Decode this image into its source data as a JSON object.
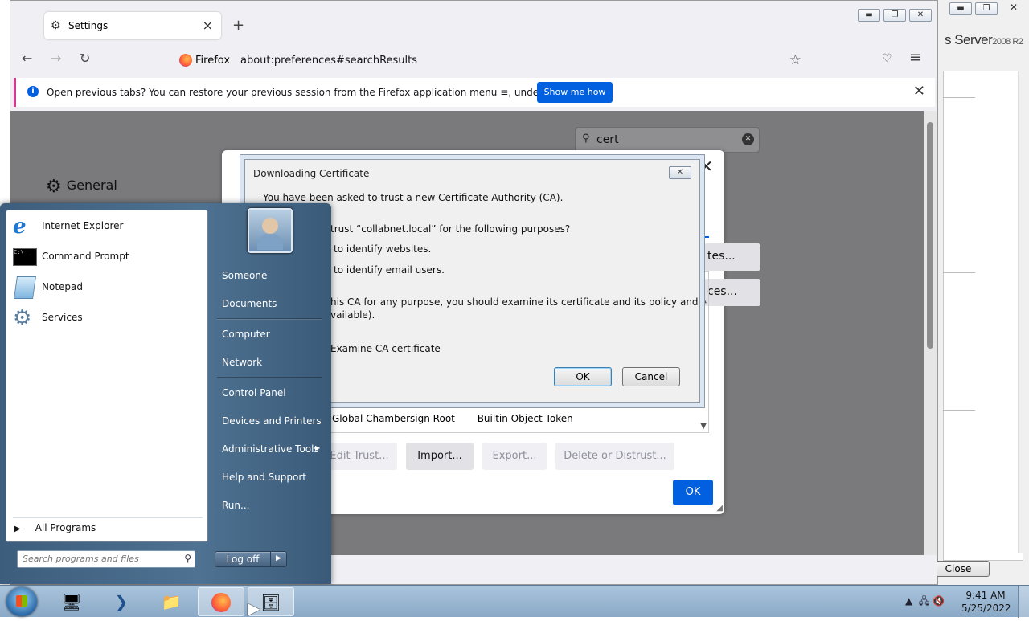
{
  "background_window": {
    "brand": "s Server",
    "brand_suffix": "2008 R2",
    "close_button": "Close",
    "min_icon": "minimize-icon",
    "max_icon": "maximize-icon",
    "close_icon": "close-icon"
  },
  "firefox": {
    "tab_title": "Settings",
    "url_identity": "Firefox",
    "url": "about:preferences#searchResults",
    "notification": {
      "message": "Open previous tabs? You can restore your previous session from the Firefox application menu ≡, under History.",
      "button": "Show me how"
    },
    "search_value": "cert",
    "sidebar_general": "General"
  },
  "cert_manager": {
    "row_name": "Global Chambersign Root",
    "row_token": "Builtin Object Token",
    "side_buttons": [
      "tes...",
      "ces..."
    ],
    "buttons": {
      "edit": "Edit Trust...",
      "import": "Import...",
      "export": "Export...",
      "delete": "Delete or Distrust..."
    },
    "ok": "OK"
  },
  "download_dialog": {
    "title": "Downloading Certificate",
    "line1": "You have been asked to trust a new Certificate Authority (CA).",
    "line2": "trust “collabnet.local” for the following purposes?",
    "opt_websites": "to identify websites.",
    "opt_email": "to identify email users.",
    "line3a": "his CA for any purpose, you should examine its certificate and its policy and",
    "line3b": "vailable).",
    "examine": "Examine CA certificate",
    "ok": "OK",
    "cancel": "Cancel"
  },
  "start_menu": {
    "programs": [
      {
        "label": "Internet Explorer",
        "icon": "internet-explorer-icon"
      },
      {
        "label": "Command Prompt",
        "icon": "command-prompt-icon"
      },
      {
        "label": "Notepad",
        "icon": "notepad-icon"
      },
      {
        "label": "Services",
        "icon": "services-icon"
      }
    ],
    "all_programs": "All Programs",
    "search_placeholder": "Search programs and files",
    "right_items": [
      "Someone",
      "Documents",
      "Computer",
      "Network",
      "Control Panel",
      "Devices and Printers",
      "Administrative Tools",
      "Help and Support",
      "Run..."
    ],
    "log_off": "Log off"
  },
  "taskbar": {
    "time": "9:41 AM",
    "date": "5/25/2022",
    "items": [
      "server-manager-icon",
      "powershell-icon",
      "file-explorer-icon",
      "firefox-icon",
      "server-icon"
    ]
  }
}
